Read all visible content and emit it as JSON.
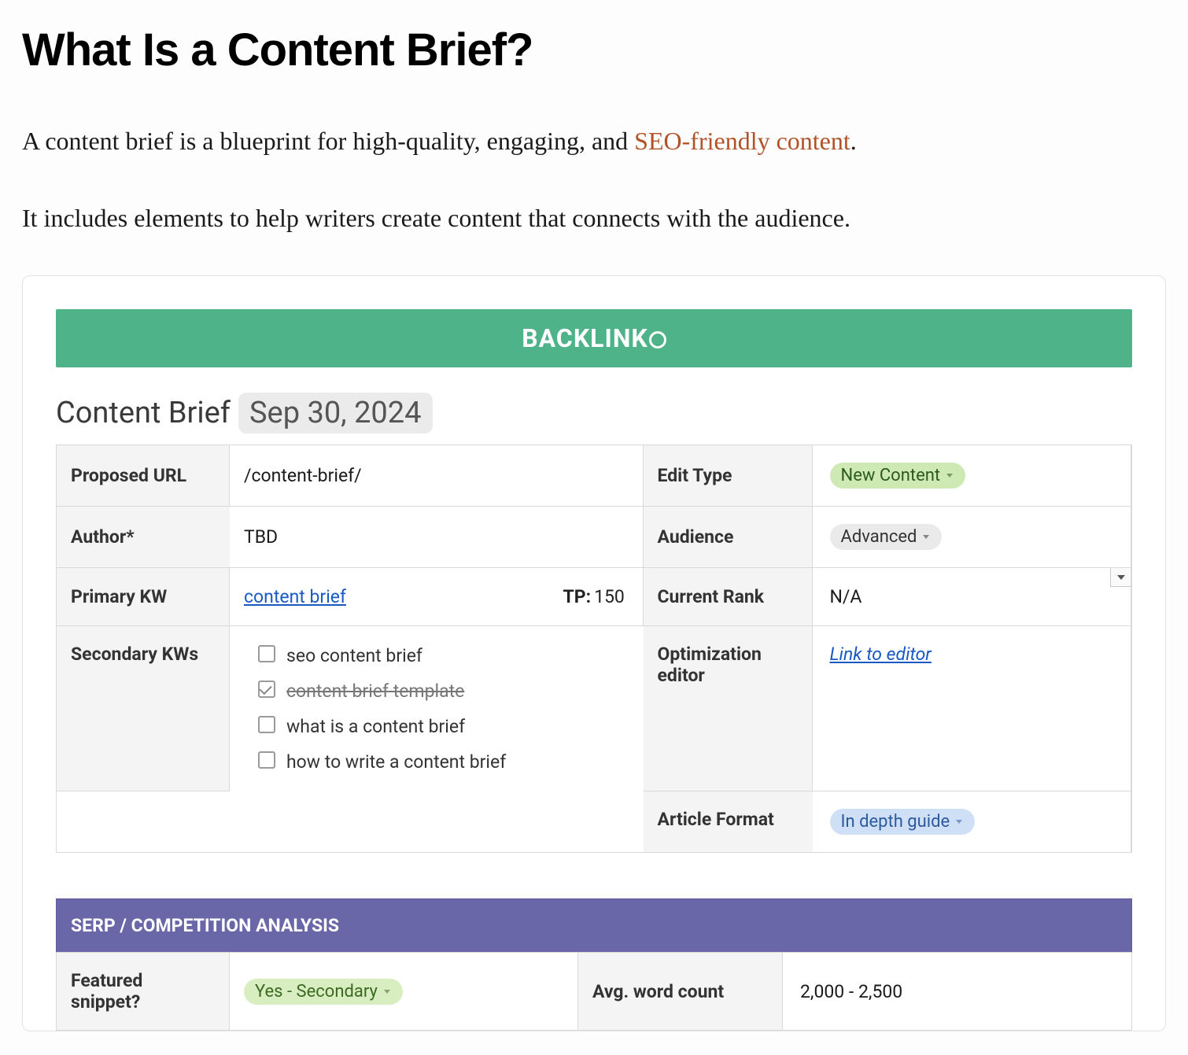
{
  "heading": "What Is a Content Brief?",
  "intro": {
    "line1_pre": "A content brief is a blueprint for high-quality, engaging, and ",
    "line1_link": "SEO-friendly content",
    "line1_post": ".",
    "line2": "It includes elements to help writers create content that connects with the audience."
  },
  "brand": "BACKLINK",
  "doc": {
    "title": "Content Brief",
    "date": "Sep 30, 2024"
  },
  "fields": {
    "proposed_url_label": "Proposed URL",
    "proposed_url_value": "/content-brief/",
    "author_label": "Author*",
    "author_value": "TBD",
    "primary_kw_label": "Primary KW",
    "primary_kw_value": "content brief",
    "tp_label": "TP:",
    "tp_value": "150",
    "secondary_kw_label": "Secondary KWs",
    "edit_type_label": "Edit Type",
    "edit_type_value": "New Content",
    "audience_label": "Audience",
    "audience_value": "Advanced",
    "current_rank_label": "Current Rank",
    "current_rank_value": "N/A",
    "opt_editor_label": "Optimization editor",
    "opt_editor_value": "Link to editor",
    "article_format_label": "Article Format",
    "article_format_value": "In depth guide"
  },
  "secondary_kws": [
    {
      "text": "seo content brief",
      "checked": false,
      "struck": false
    },
    {
      "text": "content brief template",
      "checked": true,
      "struck": true
    },
    {
      "text": "what is a content brief",
      "checked": false,
      "struck": false
    },
    {
      "text": "how to write a content brief",
      "checked": false,
      "struck": false
    }
  ],
  "section2": {
    "title": "SERP / COMPETITION ANALYSIS",
    "featured_label": "Featured snippet?",
    "featured_value": "Yes - Secondary",
    "avg_wc_label": "Avg. word count",
    "avg_wc_value": "2,000 - 2,500"
  }
}
